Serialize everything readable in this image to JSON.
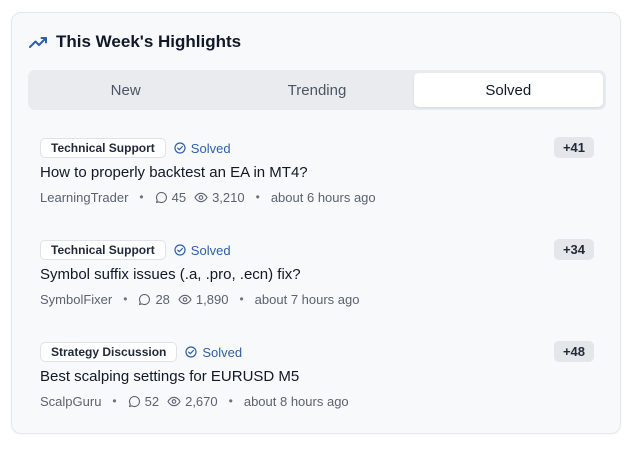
{
  "widget": {
    "title": "This Week's Highlights",
    "icon": "trending-up-icon"
  },
  "tabs": [
    {
      "label": "New",
      "active": false
    },
    {
      "label": "Trending",
      "active": false
    },
    {
      "label": "Solved",
      "active": true
    }
  ],
  "posts": [
    {
      "category": "Technical Support",
      "status": "Solved",
      "score": "+41",
      "title": "How to properly backtest an EA in MT4?",
      "author": "LearningTrader",
      "comments": "45",
      "views": "3,210",
      "time": "about 6 hours ago"
    },
    {
      "category": "Technical Support",
      "status": "Solved",
      "score": "+34",
      "title": "Symbol suffix issues (.a, .pro, .ecn) fix?",
      "author": "SymbolFixer",
      "comments": "28",
      "views": "1,890",
      "time": "about 7 hours ago"
    },
    {
      "category": "Strategy Discussion",
      "status": "Solved",
      "score": "+48",
      "title": "Best scalping settings for EURUSD M5",
      "author": "ScalpGuru",
      "comments": "52",
      "views": "2,670",
      "time": "about 8 hours ago"
    }
  ],
  "colors": {
    "accent": "#2f5fa8",
    "card_bg": "#f8f9fb",
    "tab_bg": "#e9ebef"
  }
}
